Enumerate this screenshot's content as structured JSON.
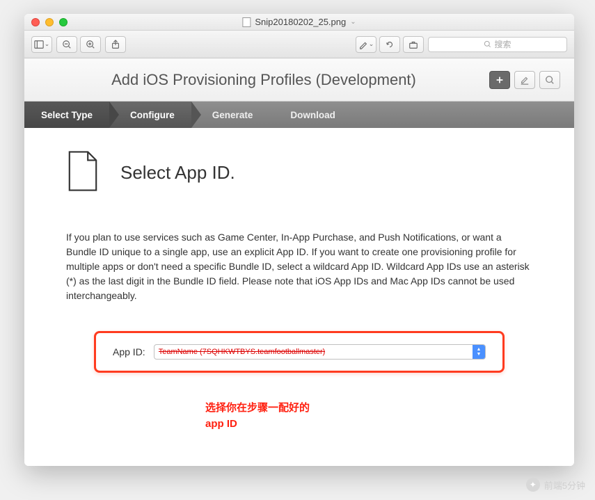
{
  "window": {
    "filename": "Snip20180202_25.png"
  },
  "toolbar": {
    "search_placeholder": "搜索"
  },
  "page": {
    "title": "Add iOS Provisioning Profiles (Development)"
  },
  "steps": {
    "s1": "Select Type",
    "s2": "Configure",
    "s3": "Generate",
    "s4": "Download"
  },
  "section": {
    "heading": "Select App ID.",
    "description": "If you plan to use services such as Game Center, In-App Purchase, and Push Notifications, or want a Bundle ID unique to a single app, use an explicit App ID. If you want to create one provisioning profile for multiple apps or don't need a specific Bundle ID, select a wildcard App ID. Wildcard App IDs use an asterisk (*) as the last digit in the Bundle ID field. Please note that iOS App IDs and Mac App IDs cannot be used interchangeably."
  },
  "form": {
    "app_id_label": "App ID:",
    "app_id_value": "TeamName (7SQHKWTBYS.teamfootballmaster)"
  },
  "annotation": {
    "line1": "选择你在步骤一配好的",
    "line2": "app ID"
  },
  "watermark": {
    "text": "前端5分钟"
  }
}
